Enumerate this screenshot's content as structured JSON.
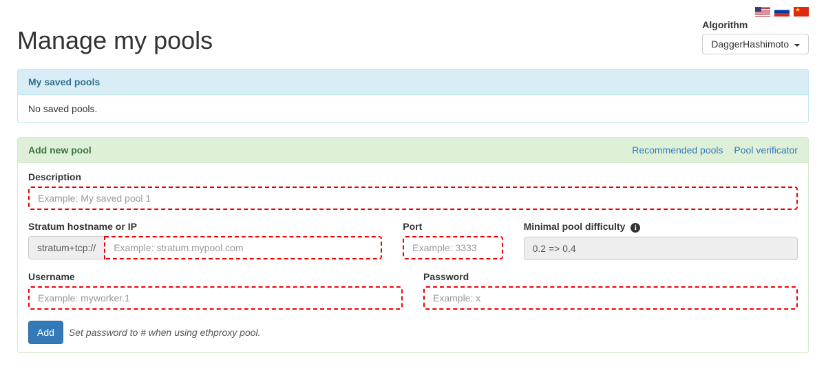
{
  "flags": [
    "us",
    "ru",
    "cn"
  ],
  "algorithm": {
    "label": "Algorithm",
    "selected": "DaggerHashimoto"
  },
  "page_title": "Manage my pools",
  "saved_panel": {
    "title": "My saved pools",
    "empty_text": "No saved pools."
  },
  "add_panel": {
    "title": "Add new pool",
    "links": {
      "recommended": "Recommended pools",
      "verificator": "Pool verificator"
    },
    "fields": {
      "description": {
        "label": "Description",
        "placeholder": "Example: My saved pool 1"
      },
      "hostname": {
        "label": "Stratum hostname or IP",
        "prefix": "stratum+tcp://",
        "placeholder": "Example: stratum.mypool.com"
      },
      "port": {
        "label": "Port",
        "placeholder": "Example: 3333"
      },
      "difficulty": {
        "label": "Minimal pool difficulty",
        "value": "0.2 => 0.4"
      },
      "username": {
        "label": "Username",
        "placeholder": "Example: myworker.1"
      },
      "password": {
        "label": "Password",
        "placeholder": "Example: x"
      }
    },
    "submit_label": "Add",
    "help_text": "Set password to # when using ethproxy pool."
  }
}
